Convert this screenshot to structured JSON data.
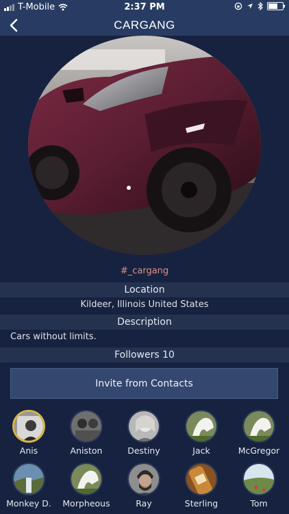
{
  "status_bar": {
    "carrier": "T-Mobile",
    "time": "2:37 PM"
  },
  "header": {
    "title": "CARGANG",
    "back_icon": "chevron-left-icon"
  },
  "group": {
    "hashtag": "#_cargang",
    "location_label": "Location",
    "location_value": "Kildeer, Illinois  United States",
    "description_label": "Description",
    "description_value": "Cars without limits.",
    "followers_label": "Followers 10"
  },
  "actions": {
    "invite_label": "Invite from Contacts"
  },
  "followers": [
    {
      "name": "Anis",
      "selected": true
    },
    {
      "name": "Aniston"
    },
    {
      "name": "Destiny"
    },
    {
      "name": "Jack"
    },
    {
      "name": "McGregor"
    },
    {
      "name": "Monkey D."
    },
    {
      "name": "Morpheous"
    },
    {
      "name": "Ray"
    },
    {
      "name": "Sterling"
    },
    {
      "name": "Tom"
    }
  ],
  "colors": {
    "background": "#16223f",
    "bar": "#283c63",
    "band": "#243250",
    "accent_gold": "#d9b645",
    "hashtag": "#e0908a"
  }
}
